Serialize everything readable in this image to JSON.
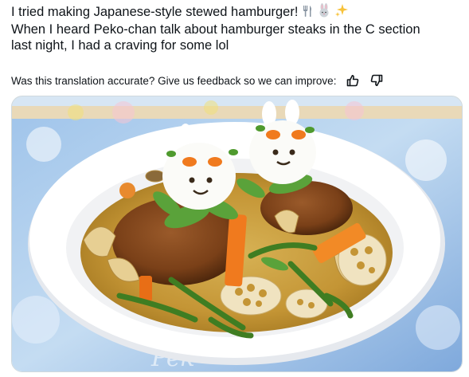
{
  "post": {
    "line1": "I tried making Japanese-style stewed hamburger!",
    "line2": "When I heard Peko-chan talk about hamburger steaks in the C section",
    "line3": "last night, I had a craving for some lol",
    "emojis": [
      "fork-and-knife-icon",
      "rabbit-icon",
      "sparkles-icon"
    ]
  },
  "feedback": {
    "text": "Was this translation accurate? Give us feedback so we can improve:"
  },
  "photo": {
    "plate_text": "Pek"
  },
  "colors": {
    "text": "#0f1419",
    "plate": "#ffffff",
    "broth": "#c59a3a",
    "carrot": "#f07a1e",
    "tablecloth": "#a9c8ec"
  }
}
